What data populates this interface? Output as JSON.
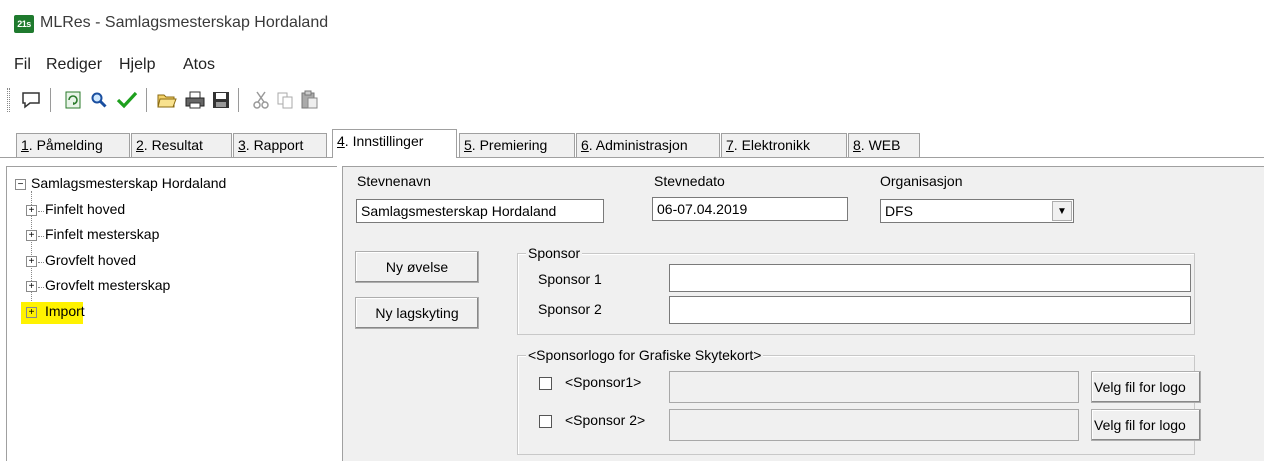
{
  "window": {
    "icon_text": "21s",
    "title": "MLRes - Samlagsmesterskap Hordaland"
  },
  "menu": [
    "Fil",
    "Rediger",
    "Hjelp",
    "Atos"
  ],
  "toolbar": {
    "icons": [
      "speech-bubble-icon",
      "refresh-icon",
      "search-icon",
      "check-icon",
      "open-folder-icon",
      "print-icon",
      "save-icon",
      "cut-icon",
      "copy-icon",
      "paste-icon"
    ]
  },
  "tabs": [
    {
      "num": "1",
      "label": ". Påmelding"
    },
    {
      "num": "2",
      "label": ". Resultat"
    },
    {
      "num": "3",
      "label": ". Rapport"
    },
    {
      "num": "4",
      "label": ". Innstillinger"
    },
    {
      "num": "5",
      "label": ". Premiering"
    },
    {
      "num": "6",
      "label": ". Administrasjon"
    },
    {
      "num": "7",
      "label": ". Elektronikk"
    },
    {
      "num": "8",
      "label": ". WEB"
    }
  ],
  "tree": {
    "root": "Samlagsmesterskap Hordaland",
    "children": [
      "Finfelt hoved",
      "Finfelt mesterskap",
      "Grovfelt hoved",
      "Grovfelt mesterskap",
      "Import"
    ]
  },
  "form": {
    "stevnenavn_label": "Stevnenavn",
    "stevnenavn_value": "Samlagsmesterskap Hordaland",
    "stevnedato_label": "Stevnedato",
    "stevnedato_value": "06-07.04.2019",
    "organisasjon_label": "Organisasjon",
    "organisasjon_value": "DFS",
    "ny_ovelse": "Ny øvelse",
    "ny_lagskyting": "Ny lagskyting",
    "sponsor_group": "Sponsor",
    "sponsor1_label": "Sponsor 1",
    "sponsor1_value": "",
    "sponsor2_label": "Sponsor 2",
    "sponsor2_value": "",
    "logo_group": "<Sponsorlogo for Grafiske Skytekort>",
    "logo1_label": "<Sponsor1>",
    "logo2_label": "<Sponsor 2>",
    "velg_fil": "Velg fil for logo"
  },
  "colors": {
    "highlight": "#fff200",
    "panel_bg": "#f0f0f0"
  }
}
